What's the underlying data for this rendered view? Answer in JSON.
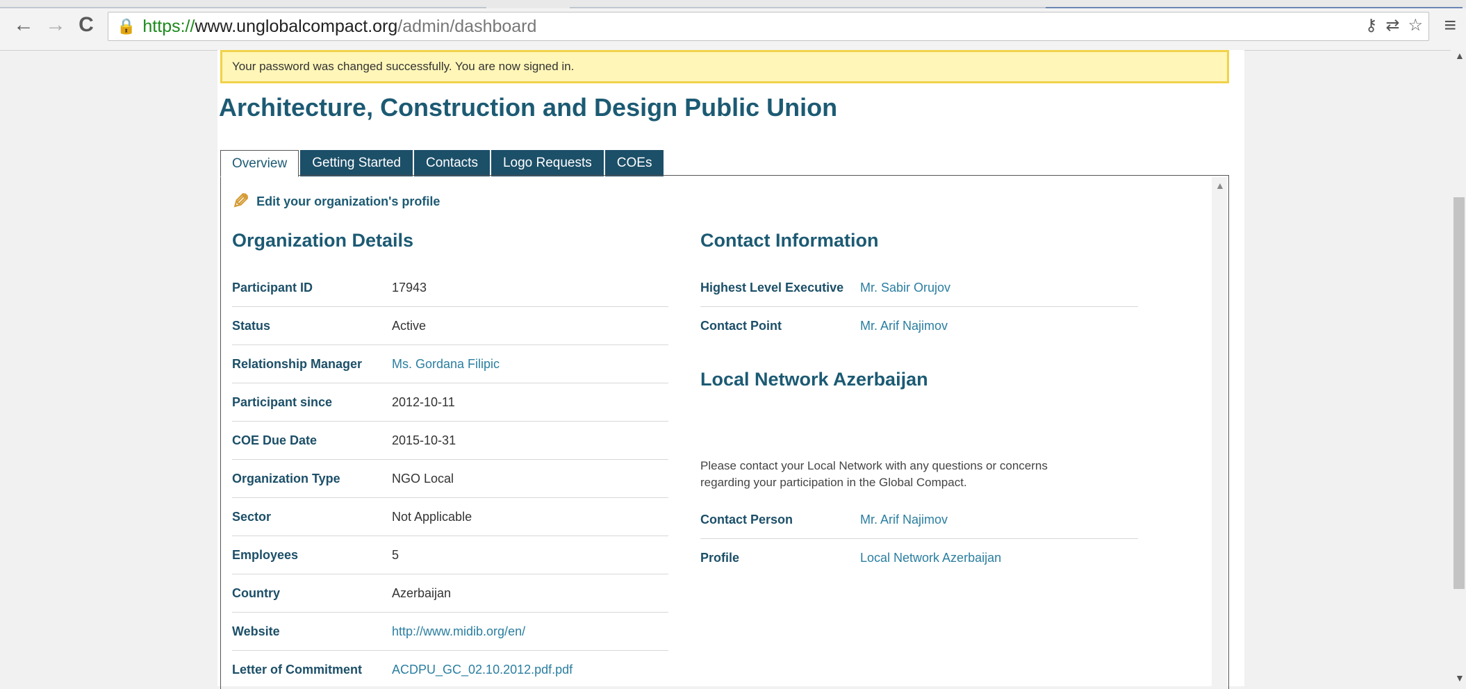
{
  "browser": {
    "back_icon": "←",
    "forward_icon": "→",
    "reload_icon": "C",
    "lock_icon": "🔒",
    "url_scheme": "https://",
    "url_host": "www.unglobalcompact.org",
    "url_path": "/admin/dashboard",
    "key_icon": "⚷",
    "translate_icon": "⇄",
    "star_icon": "☆",
    "menu_icon": "≡"
  },
  "notice": {
    "text": "Your password was changed successfully. You are now signed in."
  },
  "organization": {
    "title": "Architecture, Construction and Design Public Union"
  },
  "tabs": [
    {
      "label": "Overview"
    },
    {
      "label": "Getting Started"
    },
    {
      "label": "Contacts"
    },
    {
      "label": "Logo Requests"
    },
    {
      "label": "COEs"
    }
  ],
  "edit_profile": {
    "label": "Edit your organization's profile"
  },
  "details": {
    "heading": "Organization Details",
    "rows": [
      {
        "label": "Participant ID",
        "value": "17943"
      },
      {
        "label": "Status",
        "value": "Active"
      },
      {
        "label": "Relationship Manager",
        "value": "Ms. Gordana Filipic"
      },
      {
        "label": "Participant since",
        "value": "2012-10-11"
      },
      {
        "label": "COE Due Date",
        "value": "2015-10-31"
      },
      {
        "label": "Organization Type",
        "value": "NGO Local"
      },
      {
        "label": "Sector",
        "value": "Not Applicable"
      },
      {
        "label": "Employees",
        "value": "5"
      },
      {
        "label": "Country",
        "value": "Azerbaijan"
      },
      {
        "label": "Website",
        "value": "http://www.midib.org/en/"
      },
      {
        "label": "Letter of Commitment",
        "value": "ACDPU_GC_02.10.2012.pdf.pdf"
      }
    ]
  },
  "contact": {
    "heading": "Contact Information",
    "rows": [
      {
        "label": "Highest Level Executive",
        "value": "Mr. Sabir Orujov"
      },
      {
        "label": "Contact Point",
        "value": "Mr. Arif Najimov"
      }
    ]
  },
  "local_network": {
    "heading": "Local Network Azerbaijan",
    "note": "Please contact your Local Network with any questions or concerns regarding your participation in the Global Compact.",
    "rows": [
      {
        "label": "Contact Person",
        "value": "Mr. Arif Najimov"
      },
      {
        "label": "Profile",
        "value": "Local Network Azerbaijan"
      }
    ]
  },
  "colors": {
    "accent": "#1c5a73",
    "tab_bg": "#1c4f68",
    "link": "#2a7ea0",
    "notice_bg": "#fff6b8",
    "notice_border": "#f1d24a"
  }
}
